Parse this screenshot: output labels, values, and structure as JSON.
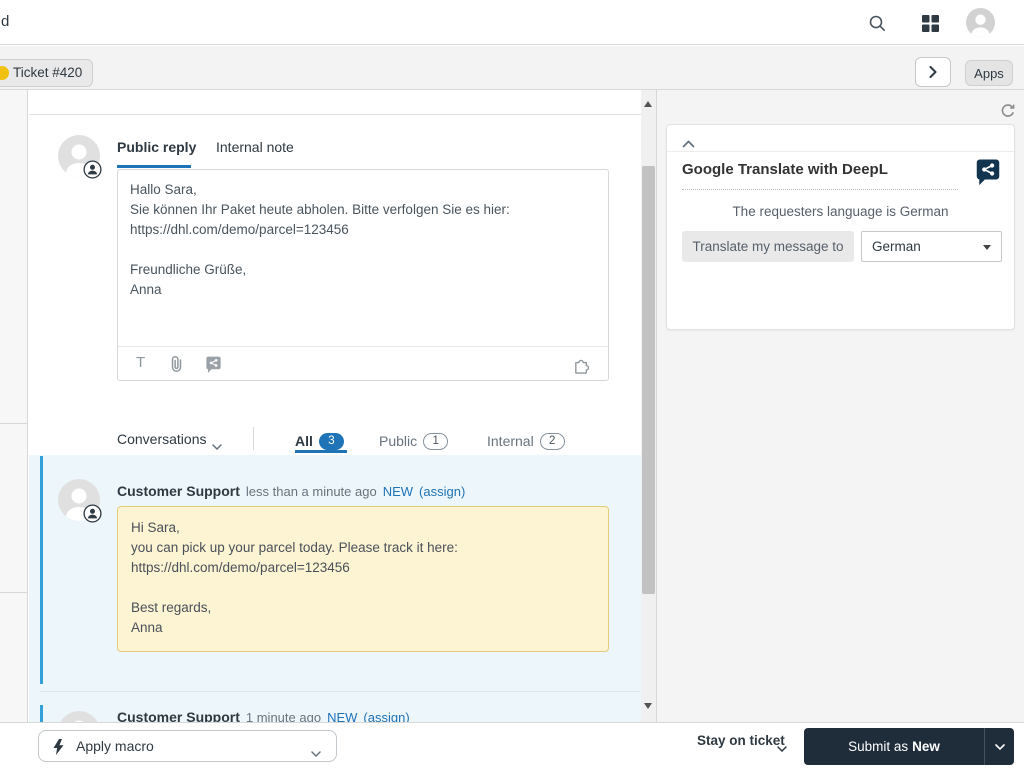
{
  "header": {
    "breadcrumb_fragment": "d"
  },
  "tab_bar": {
    "ticket_label": "Ticket #420",
    "apps_label": "Apps"
  },
  "compose": {
    "tab_public": "Public reply",
    "tab_internal": "Internal note",
    "body": "Hallo Sara,\nSie können Ihr Paket heute abholen. Bitte verfolgen Sie es hier:\nhttps://dhl.com/demo/parcel=123456\n\nFreundliche Grüße,\nAnna",
    "toolbar_text_icon": "T"
  },
  "conversations": {
    "dropdown_label": "Conversations",
    "tabs": [
      {
        "label": "All",
        "count": 3
      },
      {
        "label": "Public",
        "count": 1
      },
      {
        "label": "Internal",
        "count": 2
      }
    ],
    "messages": [
      {
        "author": "Customer Support",
        "time": "less than a minute ago",
        "status": "NEW",
        "assign_label": "(assign)",
        "body": "Hi Sara,\nyou can pick up your parcel today. Please track it here:\nhttps://dhl.com/demo/parcel=123456\n\nBest regards,\nAnna"
      },
      {
        "author": "Customer Support",
        "time": "1 minute ago",
        "status": "NEW",
        "assign_label": "(assign)"
      }
    ]
  },
  "right_panel": {
    "app_title": "Google Translate with DeepL",
    "requester_language_note": "The requesters language is German",
    "translate_button_label": "Translate my message to",
    "language_selected": "German"
  },
  "footer": {
    "apply_macro_placeholder": "Apply macro",
    "stay_on_ticket_label": "Stay on ticket",
    "submit_prefix": "Submit as",
    "submit_status": "New"
  },
  "colors": {
    "accent_blue": "#1f73b7",
    "conversation_stripe": "#33a1d7",
    "conversation_bg": "#edf6fb",
    "note_yellow_bg": "#fcf4d3",
    "note_yellow_border": "#e5ca7a",
    "ticket_dot_yellow": "#f2c10f",
    "submit_button_bg": "#1f2c39"
  }
}
